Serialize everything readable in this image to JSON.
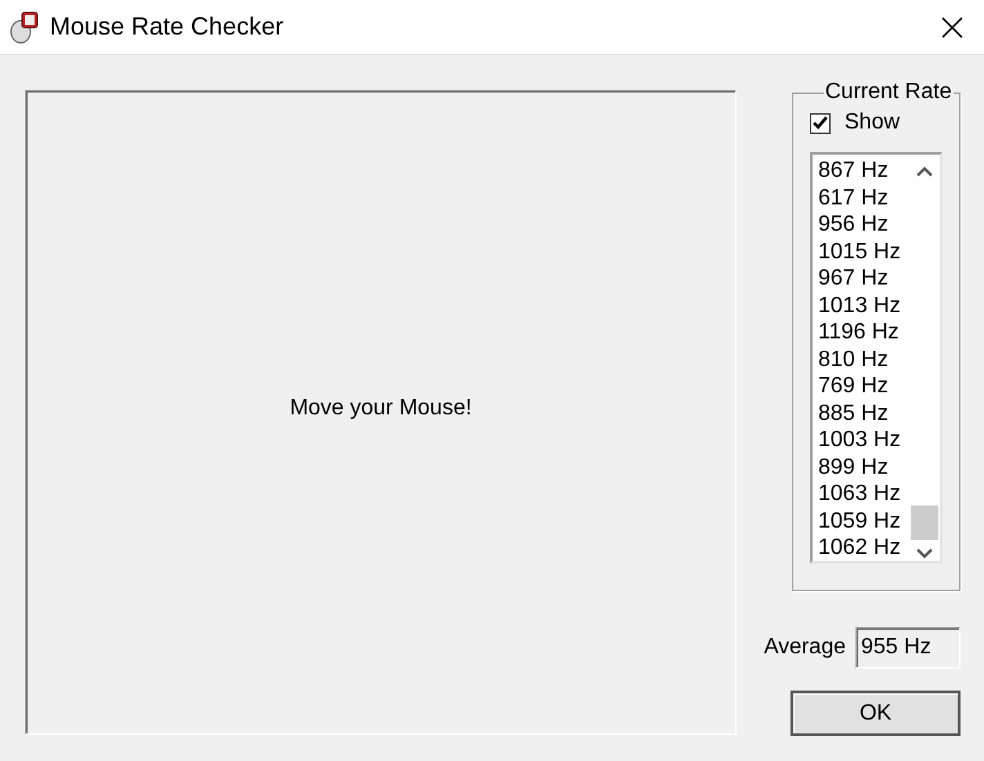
{
  "window": {
    "title": "Mouse Rate Checker"
  },
  "canvas": {
    "message": "Move your Mouse!"
  },
  "current_rate": {
    "title": "Current Rate",
    "show": {
      "label": "Show",
      "checked": true
    },
    "rates": [
      "867 Hz",
      "617 Hz",
      "956 Hz",
      "1015 Hz",
      "967 Hz",
      "1013 Hz",
      "1196 Hz",
      "810 Hz",
      "769 Hz",
      "885 Hz",
      "1003 Hz",
      "899 Hz",
      "1063 Hz",
      "1059 Hz",
      "1062 Hz"
    ]
  },
  "average": {
    "label": "Average",
    "value": "955 Hz"
  },
  "buttons": [
    "OK"
  ]
}
